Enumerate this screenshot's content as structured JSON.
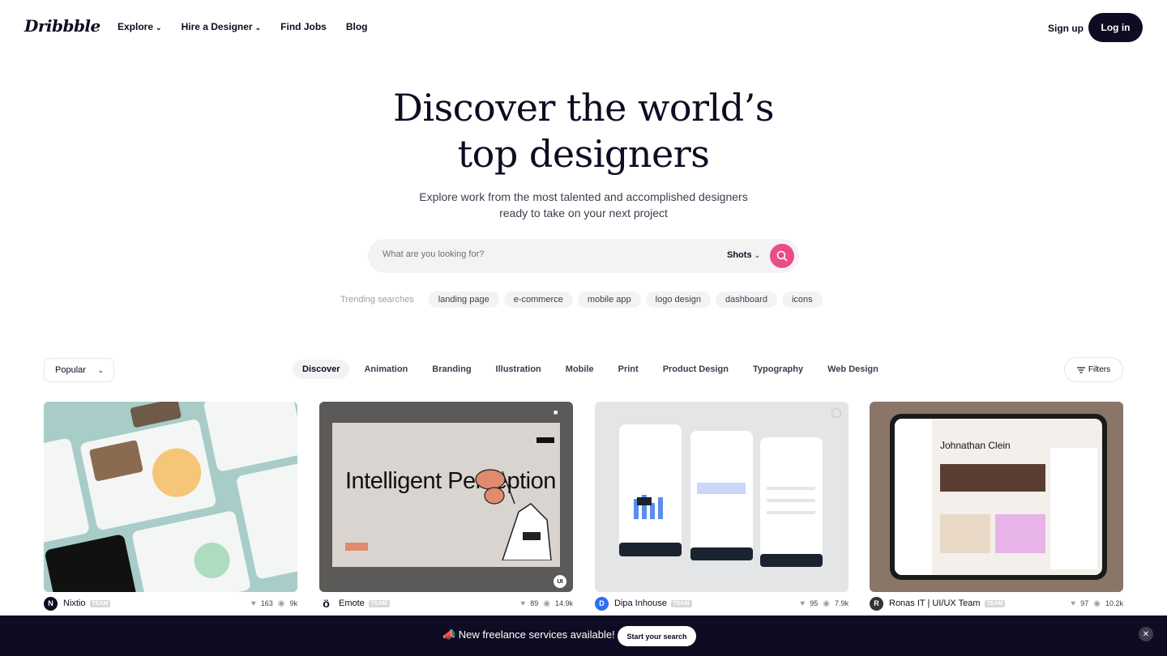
{
  "nav": {
    "logo": "Dribbble",
    "links": [
      {
        "label": "Explore",
        "has_dropdown": true
      },
      {
        "label": "Hire a Designer",
        "has_dropdown": true
      },
      {
        "label": "Find Jobs",
        "has_dropdown": false
      },
      {
        "label": "Blog",
        "has_dropdown": false
      }
    ],
    "signup": "Sign up",
    "login": "Log in"
  },
  "hero": {
    "title_line1": "Discover the world’s",
    "title_line2": "top designers",
    "subtitle_line1": "Explore work from the most talented and accomplished designers",
    "subtitle_line2": "ready to take on your next project"
  },
  "search": {
    "placeholder": "What are you looking for?",
    "type": "Shots",
    "button_color": "#ea4c89"
  },
  "trending": {
    "label": "Trending searches",
    "chips": [
      "landing page",
      "e-commerce",
      "mobile app",
      "logo design",
      "dashboard",
      "icons"
    ]
  },
  "filters": {
    "sort": "Popular",
    "categories": [
      "Discover",
      "Animation",
      "Branding",
      "Illustration",
      "Mobile",
      "Print",
      "Product Design",
      "Typography",
      "Web Design"
    ],
    "active_category": "Discover",
    "filters_label": "Filters"
  },
  "cards": [
    {
      "author": "Nixtio",
      "badge": "TEAM",
      "likes": "163",
      "views": "9k",
      "avatar_letter": "N"
    },
    {
      "author": "Emote",
      "badge": "TEAM",
      "likes": "89",
      "views": "14.9k",
      "avatar_letter": "ö",
      "thumb_title": "Intelligent Perception"
    },
    {
      "author": "Dipa Inhouse",
      "badge": "TEAM",
      "likes": "95",
      "views": "7.9k",
      "avatar_letter": "D"
    },
    {
      "author": "Ronas IT | UI/UX Team",
      "badge": "TEAM",
      "likes": "97",
      "views": "10.2k",
      "avatar_letter": "R",
      "thumb_title": "Johnathan Clein"
    }
  ],
  "banner": {
    "text": "📣 New freelance services available!",
    "button": "Start your search"
  },
  "colors": {
    "primary": "#0d0c22",
    "accent": "#ea4c89",
    "chip_bg": "#f3f3f4"
  }
}
